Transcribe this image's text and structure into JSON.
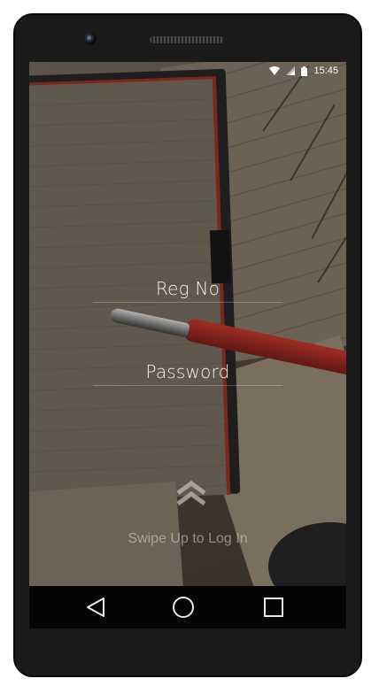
{
  "status_bar": {
    "time": "15:45",
    "icons": [
      "wifi-icon",
      "signal-icon",
      "battery-icon"
    ]
  },
  "login": {
    "reg_no_placeholder": "Reg No",
    "password_placeholder": "Password",
    "swipe_hint": "Swipe Up to Log In",
    "swipe_icon": "double-chevron-up-icon"
  },
  "nav_bar": {
    "buttons": [
      "back-icon",
      "home-icon",
      "recents-icon"
    ]
  },
  "colors": {
    "text_primary": "#f3efe9",
    "hint_text": "#dcd7cd",
    "nav_background": "#050505",
    "phone_frame": "#1a1a1a"
  }
}
